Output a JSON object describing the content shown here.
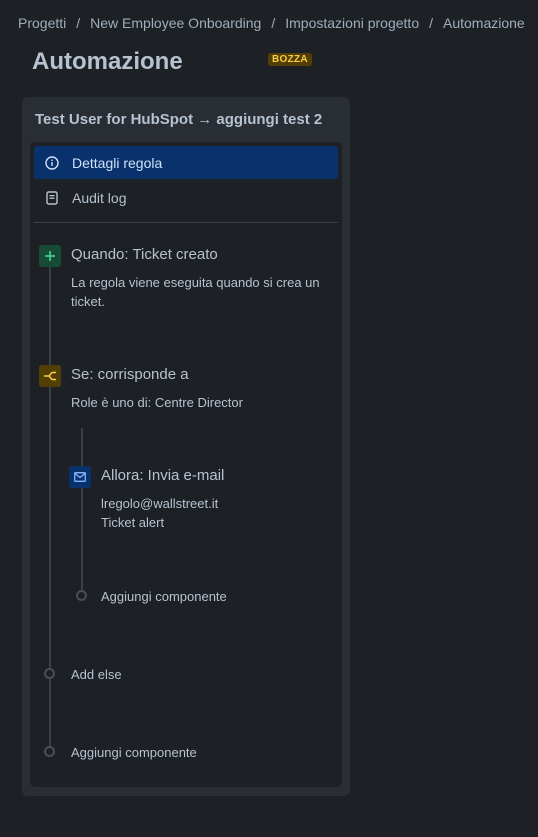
{
  "breadcrumb": [
    {
      "label": "Progetti"
    },
    {
      "label": "New Employee Onboarding"
    },
    {
      "label": "Impostazioni progetto"
    },
    {
      "label": "Automazione"
    }
  ],
  "breadcrumb_separator": "/",
  "page": {
    "title": "Automazione",
    "status_badge": "BOZZA"
  },
  "rule": {
    "name": "Test User for HubSpot → aggiungi test 2"
  },
  "nav": {
    "details_label": "Dettagli regola",
    "audit_label": "Audit log"
  },
  "flow": {
    "trigger": {
      "title": "Quando: Ticket creato",
      "description": "La regola viene eseguita quando si crea un ticket."
    },
    "condition": {
      "title": "Se: corrisponde a",
      "description": "Role è uno di: Centre Director"
    },
    "action": {
      "title": "Allora: Invia e-mail",
      "recipient": "lregolo@wallstreet.it",
      "subject": "Ticket alert"
    },
    "add_component_nested": "Aggiungi componente",
    "add_else": "Add else",
    "add_component": "Aggiungi componente"
  },
  "colors": {
    "trigger_icon_bg": "#164b35",
    "trigger_icon_fg": "#4bce97",
    "condition_icon_bg": "#533f04",
    "condition_icon_fg": "#f5cd47",
    "action_icon_bg": "#09326c",
    "action_icon_fg": "#85b8ff",
    "active_nav_bg": "#09326c"
  }
}
